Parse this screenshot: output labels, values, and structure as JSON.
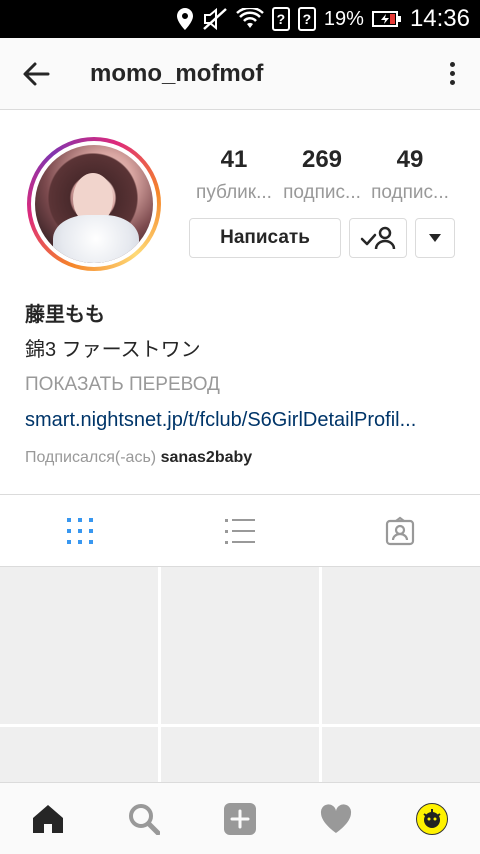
{
  "status_bar": {
    "battery_percent": "19%",
    "time": "14:36",
    "sim_indicator": "?",
    "icons": [
      "location-icon",
      "mute-icon",
      "wifi-icon",
      "sim-unknown-icon",
      "sim-unknown-icon",
      "battery-icon"
    ]
  },
  "header": {
    "title": "momo_mofmof",
    "back_icon": "arrow-left-icon",
    "more_icon": "more-vertical-icon"
  },
  "profile": {
    "stats": [
      {
        "count": "41",
        "label": "публик..."
      },
      {
        "count": "269",
        "label": "подпис..."
      },
      {
        "count": "49",
        "label": "подпис..."
      }
    ],
    "message_button": "Написать",
    "follow_icon": "following-user-icon",
    "dropdown_icon": "caret-down-icon",
    "ring_colors": [
      "#f58529",
      "#dd2a7b",
      "#8134af",
      "#feda77"
    ]
  },
  "bio": {
    "name": "藤里もも",
    "text": "錦3 ファーストワン",
    "translate": "ПОКАЗАТЬ ПЕРЕВОД",
    "link": "smart.nightsnet.jp/t/fclub/S6GirlDetailProfil...",
    "followed_label": "Подписался(-ась)",
    "followed_name": "sanas2baby"
  },
  "tabs": [
    {
      "icon": "grid-view-icon",
      "active": true
    },
    {
      "icon": "list-view-icon",
      "active": false
    },
    {
      "icon": "tagged-photos-icon",
      "active": false
    }
  ],
  "bottom_nav": [
    {
      "icon": "home-icon"
    },
    {
      "icon": "search-icon"
    },
    {
      "icon": "add-post-icon"
    },
    {
      "icon": "heart-icon"
    },
    {
      "icon": "profile-avatar-icon"
    }
  ],
  "colors": {
    "link": "#003569",
    "active_tab": "#3897f0",
    "inactive_icon": "#999999",
    "grid_placeholder": "#efefef"
  }
}
